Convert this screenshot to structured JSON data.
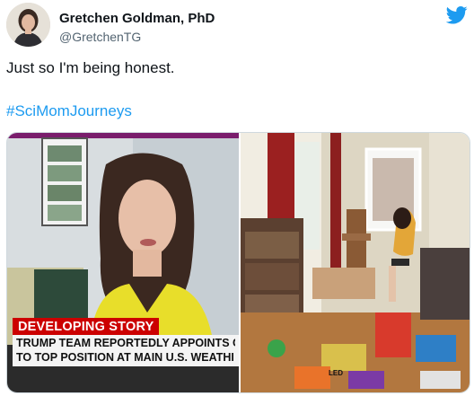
{
  "author": {
    "display_name": "Gretchen Goldman, PhD",
    "handle": "@GretchenTG"
  },
  "tweet": {
    "text": "Just so I'm being honest.",
    "hashtag": "#SciMomJourneys"
  },
  "media": {
    "left": {
      "chyron_tag": "DEVELOPING STORY",
      "chyron_line1": "TRUMP TEAM REPORTEDLY APPOINTS C",
      "chyron_line2": "TO TOP POSITION AT MAIN U.S. WEATHI"
    },
    "right": {
      "toy_label": "LED"
    }
  },
  "colors": {
    "link": "#1d9bf0",
    "twitter_bird": "#1d9bf0",
    "chyron_red": "#cc0000"
  },
  "icons": {
    "brand": "twitter-bird-icon"
  }
}
